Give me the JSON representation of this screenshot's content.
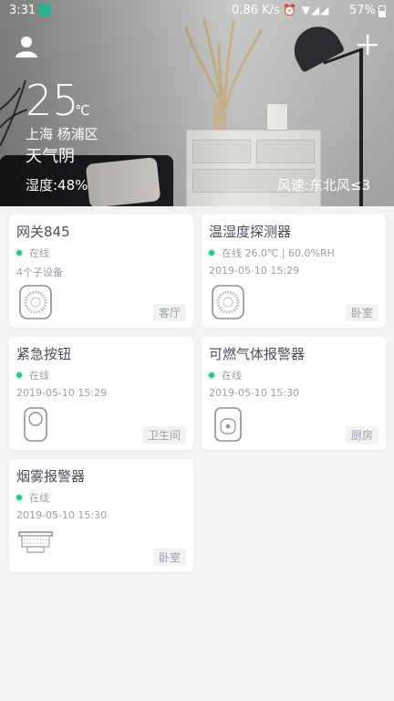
{
  "status_bar": {
    "time": "3:31",
    "net_speed": "0.86 K/s",
    "system_icons": "⏰ ▼◢◢",
    "battery": "57%"
  },
  "header": {
    "user_icon": "user-icon",
    "add_icon": "plus-icon"
  },
  "weather": {
    "temperature": "25",
    "unit": "℃",
    "location": "上海  杨浦区",
    "condition": "天气阴",
    "humidity": "湿度:48%",
    "wind": "风速:东北风≤3"
  },
  "colors": {
    "online_dot": "#2bbf8a",
    "card_bg": "#ffffff",
    "page_bg": "#f2f3f2"
  },
  "devices": [
    {
      "name": "网关845",
      "status": "在线",
      "info": "",
      "sub": "4个子设备",
      "room": "客厅",
      "icon": "gateway-icon"
    },
    {
      "name": "温湿度探测器",
      "status": "在线",
      "info": "26.0℃ | 60.0%RH",
      "sub": "2019-05-10 15:29",
      "room": "卧室",
      "icon": "sensor-icon"
    },
    {
      "name": "紧急按钮",
      "status": "在线",
      "info": "",
      "sub": "2019-05-10 15:29",
      "room": "卫生间",
      "icon": "emergency-button-icon"
    },
    {
      "name": "可燃气体报警器",
      "status": "在线",
      "info": "",
      "sub": "2019-05-10 15:30",
      "room": "厨房",
      "icon": "gas-alarm-icon"
    },
    {
      "name": "烟雾报警器",
      "status": "在线",
      "info": "",
      "sub": "2019-05-10 15:30",
      "room": "卧室",
      "icon": "smoke-alarm-icon"
    }
  ]
}
